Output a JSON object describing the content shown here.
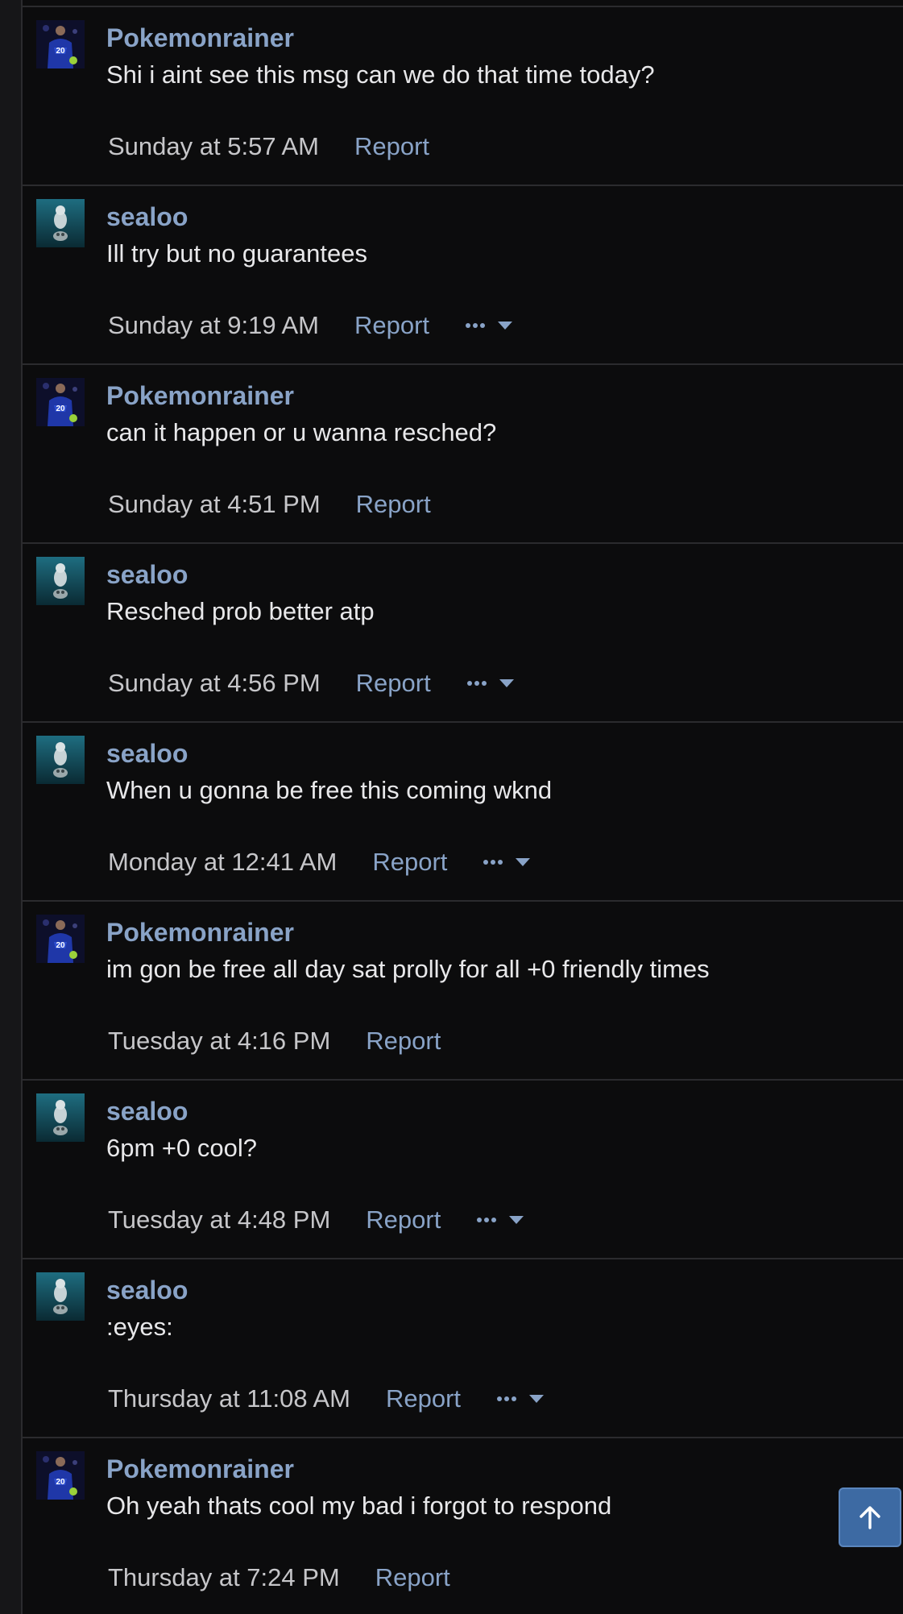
{
  "messages": [
    {
      "user": "Pokemonrainer",
      "avatar": "blue-jersey-avatar",
      "text": "Shi i aint see this msg can we do that time today?",
      "time": "Sunday at 5:57 AM",
      "report": "Report",
      "more": false
    },
    {
      "user": "sealoo",
      "avatar": "seal-avatar",
      "text": "Ill try but no guarantees",
      "time": "Sunday at 9:19 AM",
      "report": "Report",
      "more": true
    },
    {
      "user": "Pokemonrainer",
      "avatar": "blue-jersey-avatar",
      "text": "can it happen or u wanna resched?",
      "time": "Sunday at 4:51 PM",
      "report": "Report",
      "more": false
    },
    {
      "user": "sealoo",
      "avatar": "seal-avatar",
      "text": "Resched prob better atp",
      "time": "Sunday at 4:56 PM",
      "report": "Report",
      "more": true
    },
    {
      "user": "sealoo",
      "avatar": "seal-avatar",
      "text": "When u gonna be free this coming wknd",
      "time": "Monday at 12:41 AM",
      "report": "Report",
      "more": true
    },
    {
      "user": "Pokemonrainer",
      "avatar": "blue-jersey-avatar",
      "text": "im gon be free all day sat prolly for all +0 friendly times",
      "time": "Tuesday at 4:16 PM",
      "report": "Report",
      "more": false
    },
    {
      "user": "sealoo",
      "avatar": "seal-avatar",
      "text": "6pm +0 cool?",
      "time": "Tuesday at 4:48 PM",
      "report": "Report",
      "more": true
    },
    {
      "user": "sealoo",
      "avatar": "seal-avatar",
      "text": ":eyes:",
      "time": "Thursday at 11:08 AM",
      "report": "Report",
      "more": true
    },
    {
      "user": "Pokemonrainer",
      "avatar": "blue-jersey-avatar",
      "text": "Oh yeah thats cool my bad i forgot to respond",
      "time": "Thursday at 7:24 PM",
      "report": "Report",
      "more": false
    }
  ],
  "scroll_top_icon": "arrow-up-icon",
  "colors": {
    "background": "#0c0c0d",
    "username": "#89a3c7",
    "link": "#89a3c7",
    "text": "#e8e8ea",
    "time": "#c6c6c9",
    "divider": "#2b2b2e",
    "scroll_button": "#3d6aa3"
  }
}
